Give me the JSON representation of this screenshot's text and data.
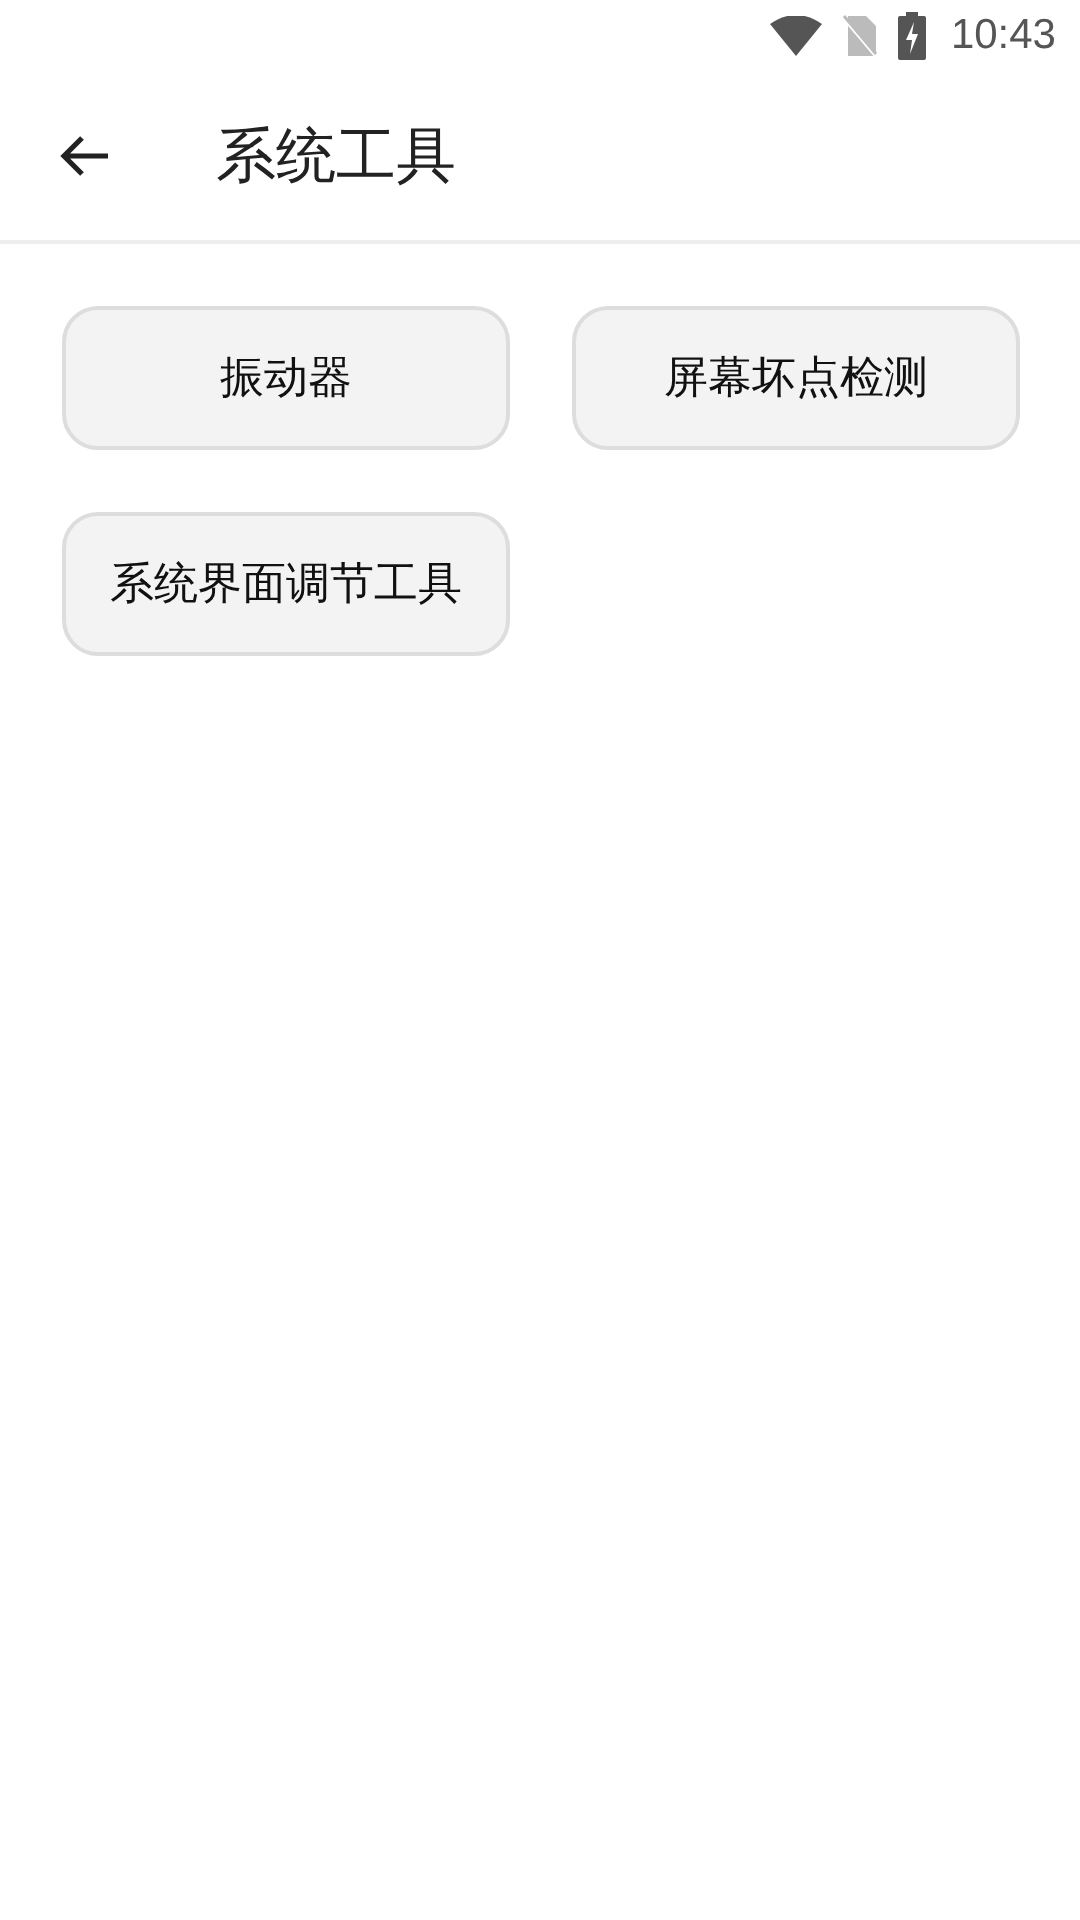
{
  "status_bar": {
    "time": "10:43"
  },
  "toolbar": {
    "title": "系统工具"
  },
  "tools": [
    {
      "label": "振动器"
    },
    {
      "label": "屏幕坏点检测"
    },
    {
      "label": "系统界面调节工具"
    }
  ]
}
